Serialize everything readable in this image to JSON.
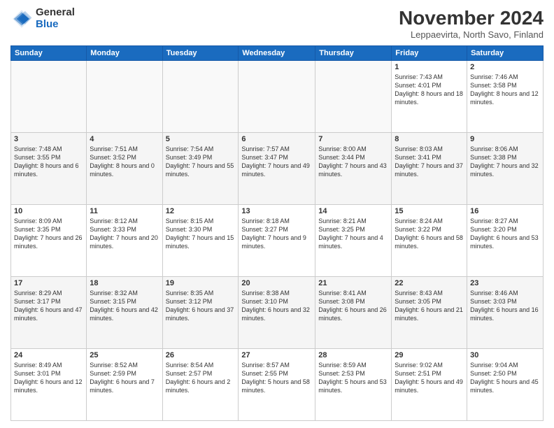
{
  "logo": {
    "general": "General",
    "blue": "Blue"
  },
  "title": "November 2024",
  "subtitle": "Leppaevirta, North Savo, Finland",
  "days_of_week": [
    "Sunday",
    "Monday",
    "Tuesday",
    "Wednesday",
    "Thursday",
    "Friday",
    "Saturday"
  ],
  "weeks": [
    [
      {
        "day": "",
        "content": ""
      },
      {
        "day": "",
        "content": ""
      },
      {
        "day": "",
        "content": ""
      },
      {
        "day": "",
        "content": ""
      },
      {
        "day": "",
        "content": ""
      },
      {
        "day": "1",
        "content": "Sunrise: 7:43 AM\nSunset: 4:01 PM\nDaylight: 8 hours and 18 minutes."
      },
      {
        "day": "2",
        "content": "Sunrise: 7:46 AM\nSunset: 3:58 PM\nDaylight: 8 hours and 12 minutes."
      }
    ],
    [
      {
        "day": "3",
        "content": "Sunrise: 7:48 AM\nSunset: 3:55 PM\nDaylight: 8 hours and 6 minutes."
      },
      {
        "day": "4",
        "content": "Sunrise: 7:51 AM\nSunset: 3:52 PM\nDaylight: 8 hours and 0 minutes."
      },
      {
        "day": "5",
        "content": "Sunrise: 7:54 AM\nSunset: 3:49 PM\nDaylight: 7 hours and 55 minutes."
      },
      {
        "day": "6",
        "content": "Sunrise: 7:57 AM\nSunset: 3:47 PM\nDaylight: 7 hours and 49 minutes."
      },
      {
        "day": "7",
        "content": "Sunrise: 8:00 AM\nSunset: 3:44 PM\nDaylight: 7 hours and 43 minutes."
      },
      {
        "day": "8",
        "content": "Sunrise: 8:03 AM\nSunset: 3:41 PM\nDaylight: 7 hours and 37 minutes."
      },
      {
        "day": "9",
        "content": "Sunrise: 8:06 AM\nSunset: 3:38 PM\nDaylight: 7 hours and 32 minutes."
      }
    ],
    [
      {
        "day": "10",
        "content": "Sunrise: 8:09 AM\nSunset: 3:35 PM\nDaylight: 7 hours and 26 minutes."
      },
      {
        "day": "11",
        "content": "Sunrise: 8:12 AM\nSunset: 3:33 PM\nDaylight: 7 hours and 20 minutes."
      },
      {
        "day": "12",
        "content": "Sunrise: 8:15 AM\nSunset: 3:30 PM\nDaylight: 7 hours and 15 minutes."
      },
      {
        "day": "13",
        "content": "Sunrise: 8:18 AM\nSunset: 3:27 PM\nDaylight: 7 hours and 9 minutes."
      },
      {
        "day": "14",
        "content": "Sunrise: 8:21 AM\nSunset: 3:25 PM\nDaylight: 7 hours and 4 minutes."
      },
      {
        "day": "15",
        "content": "Sunrise: 8:24 AM\nSunset: 3:22 PM\nDaylight: 6 hours and 58 minutes."
      },
      {
        "day": "16",
        "content": "Sunrise: 8:27 AM\nSunset: 3:20 PM\nDaylight: 6 hours and 53 minutes."
      }
    ],
    [
      {
        "day": "17",
        "content": "Sunrise: 8:29 AM\nSunset: 3:17 PM\nDaylight: 6 hours and 47 minutes."
      },
      {
        "day": "18",
        "content": "Sunrise: 8:32 AM\nSunset: 3:15 PM\nDaylight: 6 hours and 42 minutes."
      },
      {
        "day": "19",
        "content": "Sunrise: 8:35 AM\nSunset: 3:12 PM\nDaylight: 6 hours and 37 minutes."
      },
      {
        "day": "20",
        "content": "Sunrise: 8:38 AM\nSunset: 3:10 PM\nDaylight: 6 hours and 32 minutes."
      },
      {
        "day": "21",
        "content": "Sunrise: 8:41 AM\nSunset: 3:08 PM\nDaylight: 6 hours and 26 minutes."
      },
      {
        "day": "22",
        "content": "Sunrise: 8:43 AM\nSunset: 3:05 PM\nDaylight: 6 hours and 21 minutes."
      },
      {
        "day": "23",
        "content": "Sunrise: 8:46 AM\nSunset: 3:03 PM\nDaylight: 6 hours and 16 minutes."
      }
    ],
    [
      {
        "day": "24",
        "content": "Sunrise: 8:49 AM\nSunset: 3:01 PM\nDaylight: 6 hours and 12 minutes."
      },
      {
        "day": "25",
        "content": "Sunrise: 8:52 AM\nSunset: 2:59 PM\nDaylight: 6 hours and 7 minutes."
      },
      {
        "day": "26",
        "content": "Sunrise: 8:54 AM\nSunset: 2:57 PM\nDaylight: 6 hours and 2 minutes."
      },
      {
        "day": "27",
        "content": "Sunrise: 8:57 AM\nSunset: 2:55 PM\nDaylight: 5 hours and 58 minutes."
      },
      {
        "day": "28",
        "content": "Sunrise: 8:59 AM\nSunset: 2:53 PM\nDaylight: 5 hours and 53 minutes."
      },
      {
        "day": "29",
        "content": "Sunrise: 9:02 AM\nSunset: 2:51 PM\nDaylight: 5 hours and 49 minutes."
      },
      {
        "day": "30",
        "content": "Sunrise: 9:04 AM\nSunset: 2:50 PM\nDaylight: 5 hours and 45 minutes."
      }
    ]
  ]
}
